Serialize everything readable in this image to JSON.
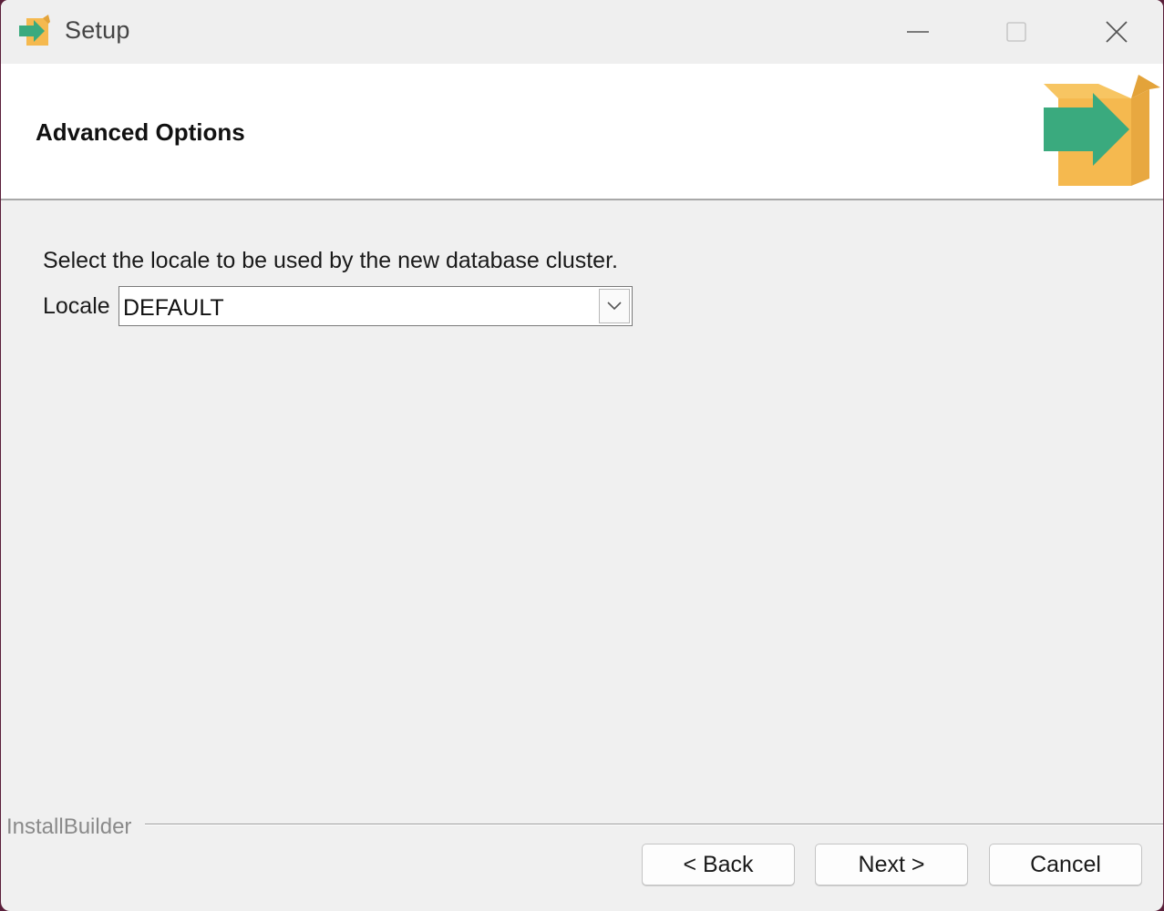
{
  "window": {
    "title": "Setup"
  },
  "header": {
    "title": "Advanced Options"
  },
  "content": {
    "instruction": "Select the locale to be used by the new database cluster.",
    "locale_label": "Locale",
    "locale_value": "DEFAULT"
  },
  "footer": {
    "brand": "InstallBuilder",
    "back_label": "< Back",
    "next_label": "Next >",
    "cancel_label": "Cancel"
  },
  "icons": {
    "app": "box-arrow-icon",
    "logo": "box-arrow-logo",
    "dropdown": "chevron-down-icon"
  },
  "colors": {
    "box": "#f5b94f",
    "arrow": "#3aaa7e"
  }
}
